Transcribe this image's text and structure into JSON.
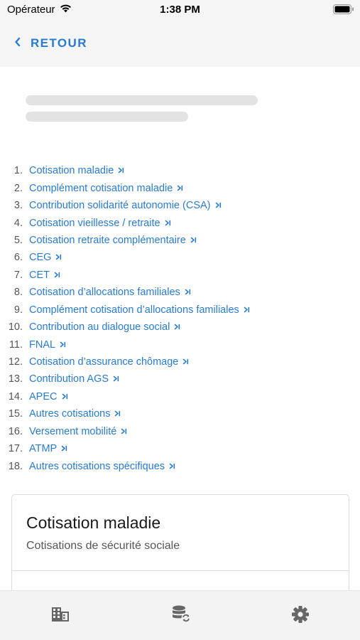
{
  "status_bar": {
    "carrier": "Opérateur",
    "time": "1:38 PM"
  },
  "header": {
    "back_label": "RETOUR"
  },
  "toc": {
    "arrow_icon": "skip-next-icon",
    "items": [
      {
        "num": "1.",
        "label": "Cotisation maladie"
      },
      {
        "num": "2.",
        "label": "Complément cotisation maladie"
      },
      {
        "num": "3.",
        "label": "Contribution solidarité autonomie (CSA)"
      },
      {
        "num": "4.",
        "label": "Cotisation vieillesse / retraite"
      },
      {
        "num": "5.",
        "label": "Cotisation retraite complémentaire"
      },
      {
        "num": "6.",
        "label": "CEG"
      },
      {
        "num": "7.",
        "label": "CET"
      },
      {
        "num": "8.",
        "label": "Cotisation d’allocations familiales"
      },
      {
        "num": "9.",
        "label": "Complément cotisation d’allocations familiales"
      },
      {
        "num": "10.",
        "label": "Contribution au dialogue social"
      },
      {
        "num": "11.",
        "label": "FNAL"
      },
      {
        "num": "12.",
        "label": "Cotisation d’assurance chômage"
      },
      {
        "num": "13.",
        "label": "Contribution AGS"
      },
      {
        "num": "14.",
        "label": "APEC"
      },
      {
        "num": "15.",
        "label": "Autres cotisations"
      },
      {
        "num": "16.",
        "label": "Versement mobilité"
      },
      {
        "num": "17.",
        "label": "ATMP"
      },
      {
        "num": "18.",
        "label": "Autres cotisations spécifiques"
      }
    ]
  },
  "card": {
    "title": "Cotisation maladie",
    "subtitle": "Cotisations de sécurité sociale"
  },
  "tab_bar": {
    "tabs": [
      {
        "icon": "building-icon"
      },
      {
        "icon": "database-sync-icon"
      },
      {
        "icon": "gear-icon"
      }
    ]
  },
  "colors": {
    "accent": "#2a7bd0",
    "header_bg": "#f5f5f5",
    "skeleton": "#e3e3e3",
    "icon_gray": "#666666"
  }
}
